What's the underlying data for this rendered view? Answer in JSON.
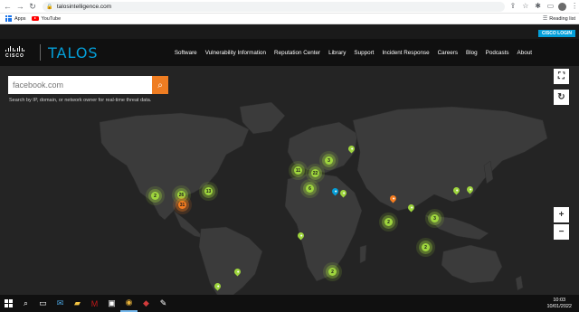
{
  "browser": {
    "url": "talosintelligence.com",
    "bookmarks": [
      {
        "label": "Apps",
        "icon": "apps-grid-icon"
      },
      {
        "label": "YouTube",
        "icon": "youtube-icon"
      }
    ],
    "reading_list_label": "Reading list"
  },
  "site": {
    "cisco_login_label": "CISCO LOGIN",
    "cisco_word": "CISCO",
    "talos_word": "TALOS",
    "nav": [
      "Software",
      "Vulnerability Information",
      "Reputation Center",
      "Library",
      "Support",
      "Incident Response",
      "Careers",
      "Blog",
      "Podcasts",
      "About"
    ]
  },
  "map": {
    "search_placeholder": "facebook.com",
    "search_hint": "Search by IP, domain, or network owner for real-time threat data.",
    "clusters": [
      {
        "label": "2",
        "color": "green"
      },
      {
        "label": "26",
        "color": "green"
      },
      {
        "label": "13",
        "color": "green"
      },
      {
        "label": "31",
        "color": "orange"
      },
      {
        "label": "11",
        "color": "green"
      },
      {
        "label": "22",
        "color": "green"
      },
      {
        "label": "3",
        "color": "green"
      },
      {
        "label": "6",
        "color": "green"
      },
      {
        "label": "2",
        "color": "green"
      },
      {
        "label": "3",
        "color": "green"
      },
      {
        "label": "2",
        "color": "green"
      },
      {
        "label": "2",
        "color": "green"
      }
    ],
    "controls": {
      "fullscreen": "⛶",
      "reset": "↻",
      "zoom_in": "+",
      "zoom_out": "−"
    },
    "colors": {
      "green": "#9ed53d",
      "orange": "#f47c20",
      "blue": "#049fd9",
      "accent": "#ef7d22"
    }
  },
  "taskbar": {
    "time": "10:03",
    "date": "10/01/2022"
  }
}
